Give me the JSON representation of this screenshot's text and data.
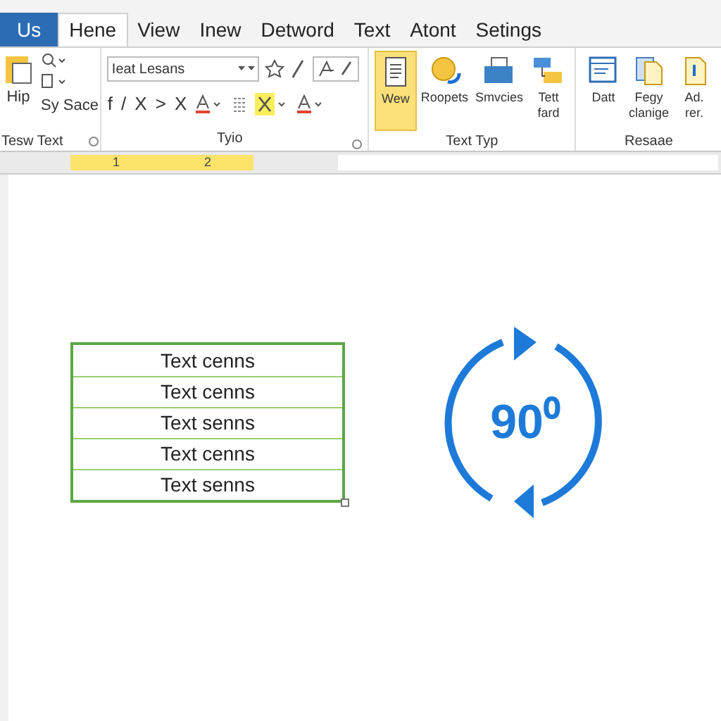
{
  "tabs": [
    {
      "label": "Us",
      "kind": "file",
      "selected": false
    },
    {
      "label": "Hene",
      "kind": "tab",
      "selected": true
    },
    {
      "label": "View",
      "kind": "tab",
      "selected": false
    },
    {
      "label": "Inew",
      "kind": "tab",
      "selected": false
    },
    {
      "label": "Detword",
      "kind": "tab",
      "selected": false
    },
    {
      "label": "Text",
      "kind": "tab",
      "selected": false
    },
    {
      "label": "Atont",
      "kind": "tab",
      "selected": false
    },
    {
      "label": "Setings",
      "kind": "tab",
      "selected": false
    }
  ],
  "clipboard_group": {
    "big_button": "Hip",
    "small_button": "Sy Sace",
    "label": "Tesw Text"
  },
  "font_group": {
    "font_field": "Ieat Lesans",
    "format_buttons": [
      "f",
      "/",
      "X",
      ">",
      "X"
    ],
    "label": "Tyio"
  },
  "large_buttons": [
    {
      "label": "Wew",
      "selected": true
    },
    {
      "label": "Roopets",
      "selected": false
    },
    {
      "label": "Smvcies",
      "selected": false
    },
    {
      "label": "Tett fard",
      "selected": false
    },
    {
      "label": "Datt",
      "selected": false
    },
    {
      "label": "Fegy clanige",
      "selected": false
    },
    {
      "label": "Ad. rer.",
      "selected": false
    }
  ],
  "group_labels": [
    "Text Typ",
    "Resaae"
  ],
  "ruler": {
    "labels": [
      "1",
      "2"
    ]
  },
  "table": {
    "rows": [
      "Text cenns",
      "Text cenns",
      "Text senns",
      "Text cenns",
      "Text senns"
    ]
  },
  "rotation": {
    "label": "90⁰"
  }
}
